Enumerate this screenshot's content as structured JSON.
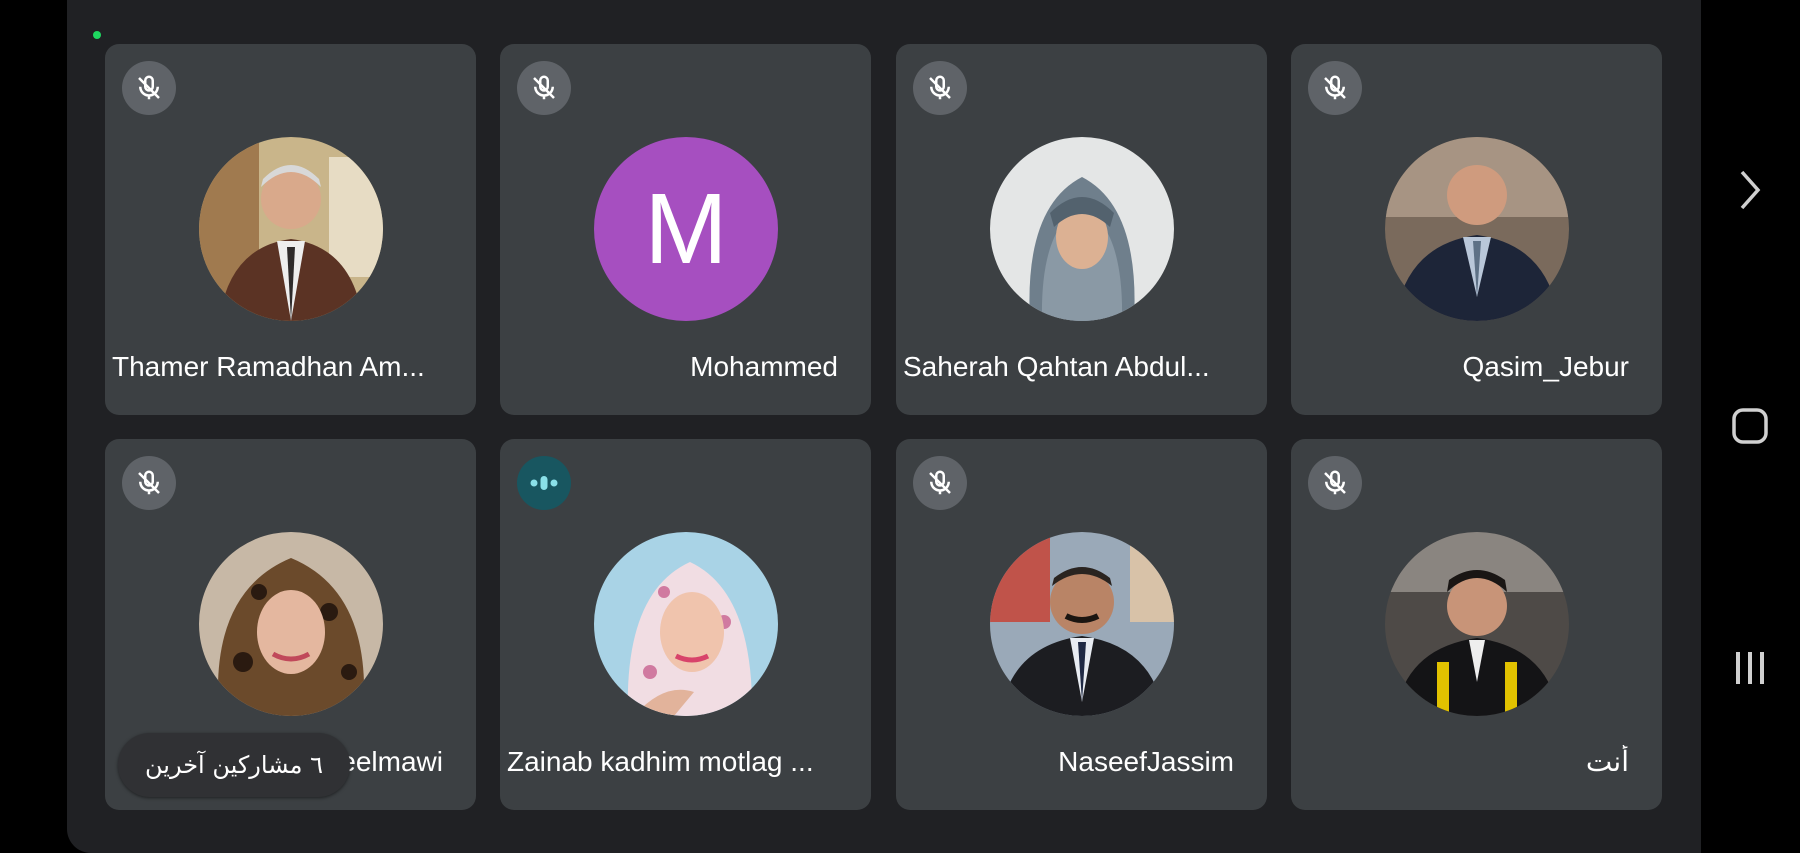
{
  "participants": [
    {
      "name": "Thamer Ramadhan Am...",
      "mic": "muted",
      "avatar": "photo-man-brown-jacket"
    },
    {
      "name": "Mohammed",
      "mic": "muted",
      "avatar": "letter",
      "letter": "M",
      "color": "#a64fc0"
    },
    {
      "name": "Saherah Qahtan Abdul...",
      "mic": "muted",
      "avatar": "photo-woman-hijab-grey"
    },
    {
      "name": "Qasim_Jebur",
      "mic": "muted",
      "avatar": "photo-man-suit-blue-tie"
    },
    {
      "name": "Fatima Al-Museelmawi",
      "mic": "muted",
      "avatar": "photo-woman-leopard-hijab"
    },
    {
      "name": "Zainab kadhim motlag ...",
      "mic": "speaking",
      "avatar": "photo-woman-floral-hijab"
    },
    {
      "name": "NaseefJassim",
      "mic": "muted",
      "avatar": "photo-man-dark-suit"
    },
    {
      "name": "أنت",
      "mic": "muted",
      "avatar": "photo-young-man-graduation"
    }
  ],
  "toast_text": "٦ مشاركين آخرين",
  "colors": {
    "stage": "#202124",
    "tile": "#3c4043",
    "muted_badge": "#5f6368",
    "speaking_badge": "#185660",
    "status_dot": "#1ed760"
  },
  "nav": {
    "forward_icon": "chevron-right-icon",
    "home_icon": "home-square-icon",
    "recents_icon": "recents-icon"
  }
}
